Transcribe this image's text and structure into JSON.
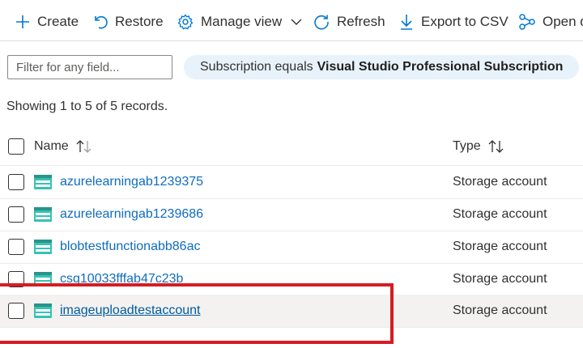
{
  "toolbar": {
    "create": "Create",
    "restore": "Restore",
    "manage_view": "Manage view",
    "refresh": "Refresh",
    "export": "Export to CSV",
    "open": "Open q"
  },
  "filter": {
    "placeholder": "Filter for any field...",
    "pill_prefix": "Subscription equals",
    "pill_value": "Visual Studio Professional Subscription"
  },
  "record_count": "Showing 1 to 5 of 5 records.",
  "table": {
    "columns": [
      "Name",
      "Type"
    ],
    "rows": [
      {
        "name": "azurelearningab1239375",
        "type": "Storage account"
      },
      {
        "name": "azurelearningab1239686",
        "type": "Storage account"
      },
      {
        "name": "blobtestfunctionabb86ac",
        "type": "Storage account"
      },
      {
        "name": "csg10033fffab47c23b",
        "type": "Storage account"
      },
      {
        "name": "imageuploadtestaccount",
        "type": "Storage account"
      }
    ]
  },
  "icons": {
    "create": "plus-icon",
    "restore": "undo-icon",
    "manage_view": "gear-icon",
    "refresh": "refresh-icon",
    "export": "download-icon",
    "open": "share-icon",
    "resource": "storage-account-icon",
    "sort": "sort-icon"
  },
  "colors": {
    "accent": "#0078d4",
    "link": "#0f6cbd",
    "pill_bg": "#e8f2fb",
    "highlight_border": "#d71b23"
  }
}
